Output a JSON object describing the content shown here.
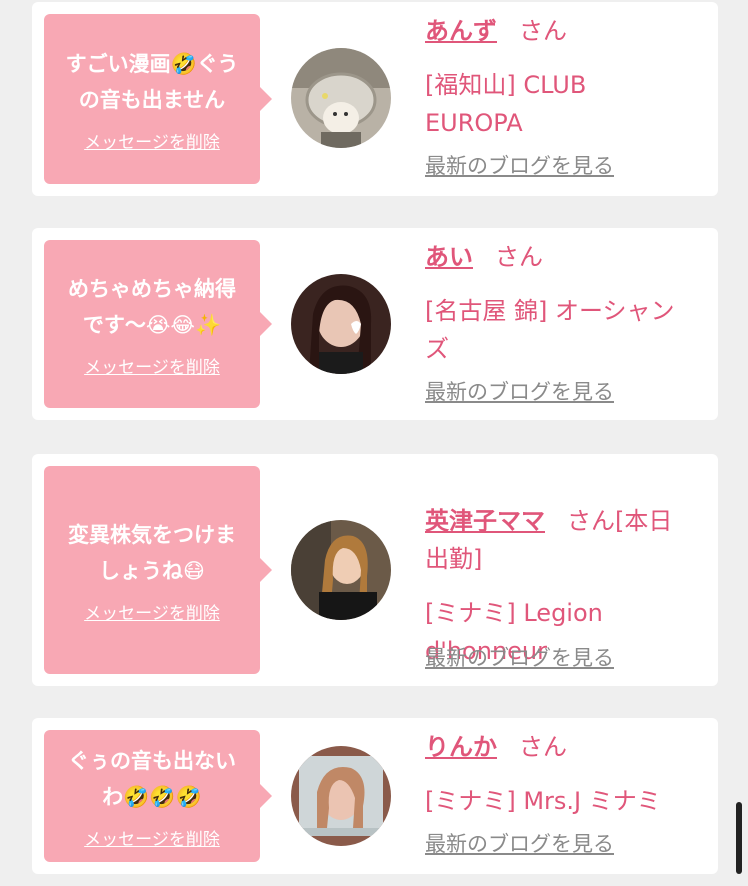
{
  "messages": [
    {
      "text": "すごい漫画🤣ぐう\nの音も出ません",
      "delete_label": "メッセージを削除",
      "name": "あんず",
      "honorific": "さん",
      "shop": "[福知山] CLUB\nEUROPA",
      "blog_label": "最新のブログを見る",
      "avatar_icon": "hamster-photo-avatar"
    },
    {
      "text": "めちゃめちゃ納得\nです〜😭😂✨",
      "delete_label": "メッセージを削除",
      "name": "あい",
      "honorific": "さん",
      "shop": "[名古屋 錦] オーシャン\nズ",
      "blog_label": "最新のブログを見る",
      "avatar_icon": "woman-photo-avatar"
    },
    {
      "text": "変異株気をつけま\nしょうね😷",
      "delete_label": "メッセージを削除",
      "name": "英津子ママ",
      "honorific": "さん[本日\n出勤]",
      "shop": "[ミナミ] Legion\nd'honneur",
      "blog_label": "最新のブログを見る",
      "avatar_icon": "woman-photo-avatar"
    },
    {
      "text": "ぐぅの音も出ない\nわ🤣🤣🤣",
      "delete_label": "メッセージを削除",
      "name": "りんか",
      "honorific": "さん",
      "shop": "[ミナミ] Mrs.J ミナミ",
      "blog_label": "最新のブログを見る",
      "avatar_icon": "woman-photo-avatar"
    }
  ],
  "colors": {
    "accent": "#e0567a",
    "bubble": "#f8a8b4",
    "link_gray": "#8a8a8a",
    "background": "#efefef"
  }
}
